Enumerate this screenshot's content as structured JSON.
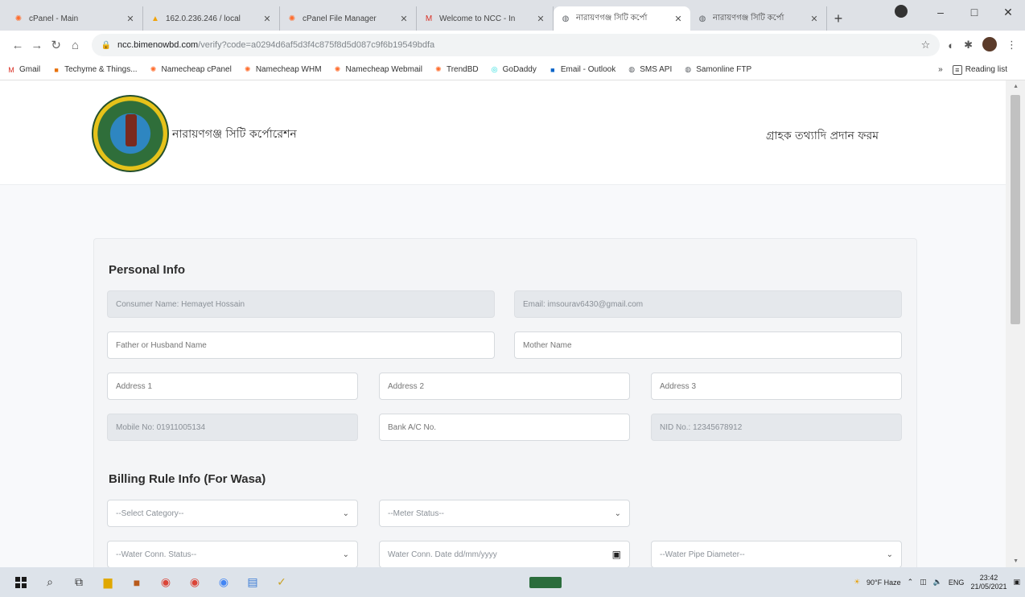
{
  "browser": {
    "tabs": [
      {
        "label": "cPanel - Main",
        "icon": "cpanel-icon",
        "color": "#ff6c2c",
        "active": false
      },
      {
        "label": "162.0.236.246 / local",
        "icon": "phpmyadmin-icon",
        "color": "#f0a30a",
        "active": false
      },
      {
        "label": "cPanel File Manager",
        "icon": "cpanel-icon",
        "color": "#ff6c2c",
        "active": false
      },
      {
        "label": "Welcome to NCC - In",
        "icon": "gmail-icon",
        "color": "#d93025",
        "active": false
      },
      {
        "label": "নারায়ণগঞ্জ সিটি কর্পো",
        "icon": "globe-icon",
        "color": "#5f6368",
        "active": true
      },
      {
        "label": "নারায়ণগঞ্জ সিটি কর্পো",
        "icon": "globe-icon",
        "color": "#5f6368",
        "active": false
      }
    ],
    "new_tab": "+",
    "url_host": "ncc.bimenowbd.com",
    "url_path": "/verify?code=a0294d6af5d3f4c875f8d5d087c9f6b19549bdfa",
    "bookmarks": [
      {
        "label": "Gmail",
        "icon": "gmail-icon",
        "color": "#d93025"
      },
      {
        "label": "Techyme & Things...",
        "icon": "bookmark-icon",
        "color": "#e8710a"
      },
      {
        "label": "Namecheap cPanel",
        "icon": "cpanel-icon",
        "color": "#ff6c2c"
      },
      {
        "label": "Namecheap WHM",
        "icon": "cpanel-icon",
        "color": "#ff6c2c"
      },
      {
        "label": "Namecheap Webmail",
        "icon": "cpanel-icon",
        "color": "#ff6c2c"
      },
      {
        "label": "TrendBD",
        "icon": "cpanel-icon",
        "color": "#ff6c2c"
      },
      {
        "label": "GoDaddy",
        "icon": "godaddy-icon",
        "color": "#1bdbdb"
      },
      {
        "label": "Email - Outlook",
        "icon": "outlook-icon",
        "color": "#0a64c8"
      },
      {
        "label": "SMS API",
        "icon": "globe-icon",
        "color": "#5f6368"
      },
      {
        "label": "Samonline FTP",
        "icon": "globe-icon",
        "color": "#5f6368"
      }
    ],
    "reading_list": "Reading list"
  },
  "site": {
    "title": "নারায়ণগঞ্জ সিটি কর্পোরেশন",
    "form_title": "গ্রাহক তথ্যাদি প্রদান ফরম"
  },
  "form": {
    "personal_heading": "Personal Info",
    "consumer_name": "Consumer Name: Hemayet Hossain",
    "email": "Email: imsourav6430@gmail.com",
    "father_placeholder": "Father or Husband Name",
    "mother_placeholder": "Mother Name",
    "address1_placeholder": "Address 1",
    "address2_placeholder": "Address 2",
    "address3_placeholder": "Address 3",
    "mobile": "Mobile No: 01911005134",
    "bank_placeholder": "Bank A/C No.",
    "nid": "NID No.: 12345678912",
    "billing_heading": "Billing Rule Info (For Wasa)",
    "category_select": "--Select Category--",
    "meter_status_select": "--Meter Status--",
    "water_conn_status_select": "--Water Conn. Status--",
    "water_conn_date": "Water Conn. Date dd/mm/yyyy",
    "water_pipe_select": "--Water Pipe Diameter--"
  },
  "taskbar": {
    "weather": "90°F Haze",
    "language": "ENG",
    "time": "23:42",
    "date": "21/05/2021"
  }
}
